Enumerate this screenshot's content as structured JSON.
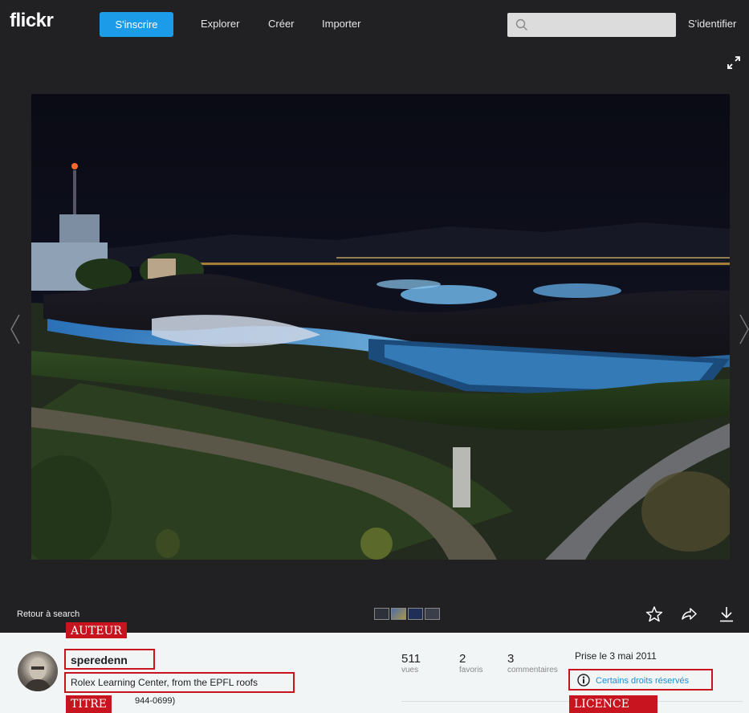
{
  "nav": {
    "logo": "flickr",
    "signup_label": "S'inscrire",
    "links": [
      "Explorer",
      "Créer",
      "Importer"
    ],
    "search_placeholder": "",
    "signin_label": "S'identifier"
  },
  "viewer": {
    "back_label": "Retour à search"
  },
  "photo_info": {
    "author": "speredenn",
    "title": "Rolex Learning Center, from the EPFL roofs",
    "description_visible": "944-0699)",
    "stats": [
      {
        "value": "511",
        "label": "vues"
      },
      {
        "value": "2",
        "label": "favoris"
      },
      {
        "value": "3",
        "label": "commentaires"
      }
    ],
    "taken": "Prise le 3 mai 2011",
    "license": "Certains droits réservés"
  },
  "annotations": {
    "author_tag": "AUTEUR",
    "title_tag": "TITRE",
    "license_tag": "LICENCE"
  },
  "colors": {
    "accent": "#1c9be9",
    "annotation_red": "#c7141f"
  }
}
